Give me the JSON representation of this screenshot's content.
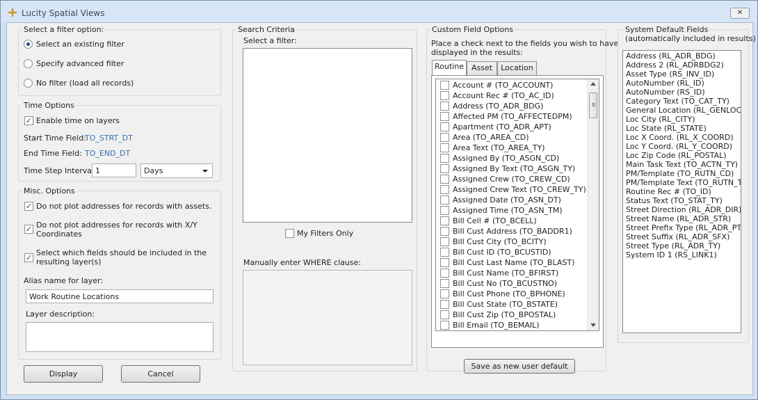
{
  "window": {
    "title": "Lucity Spatial Views",
    "close_label": "✕"
  },
  "filter_option": {
    "title": "Select a filter option:",
    "options": [
      {
        "label": "Select an existing filter",
        "selected": true
      },
      {
        "label": "Specify advanced filter",
        "selected": false
      },
      {
        "label": "No filter (load all records)",
        "selected": false
      }
    ]
  },
  "time_options": {
    "title": "Time Options",
    "enable_label": "Enable time on layers",
    "enable_checked": true,
    "start_label": "Start Time Field:",
    "start_value": "TO_STRT_DT",
    "end_label": "End Time Field:",
    "end_value": "TO_END_DT",
    "step_label": "Time Step Interval:",
    "step_value": "1",
    "step_unit": "Days"
  },
  "misc": {
    "title": "Misc. Options",
    "opt1": "Do not plot addresses for records with assets.",
    "opt2_line1": "Do not plot addresses for records with X/Y",
    "opt2_line2": "Coordinates",
    "opt3_line1": "Select which fields should be included in the",
    "opt3_line2": "resulting layer(s)",
    "alias_label": "Alias name for layer:",
    "alias_value": "Work Routine Locations",
    "desc_label": "Layer description:",
    "desc_value": ""
  },
  "buttons": {
    "display": "Display",
    "cancel": "Cancel",
    "save_default": "Save as new user default"
  },
  "search": {
    "title": "Search Criteria",
    "select_label": "Select a filter:",
    "my_filters_label": "My Filters Only",
    "where_label": "Manually enter WHERE clause:"
  },
  "custom": {
    "title": "Custom Field Options",
    "instruction_line1": "Place a check next to the fields you wish to have",
    "instruction_line2": "displayed in the results:",
    "tabs": [
      "Routine",
      "Asset",
      "Location"
    ],
    "fields": [
      "Account # (TO_ACCOUNT)",
      "Account Rec # (TO_AC_ID)",
      "Address (TO_ADR_BDG)",
      "Affected PM (TO_AFFECTEDPM)",
      "Apartment (TO_ADR_APT)",
      "Area (TO_AREA_CD)",
      "Area Text (TO_AREA_TY)",
      "Assigned By (TO_ASGN_CD)",
      "Assigned By Text (TO_ASGN_TY)",
      "Assigned Crew (TO_CREW_CD)",
      "Assigned Crew Text (TO_CREW_TY)",
      "Assigned Date (TO_ASN_DT)",
      "Assigned Time (TO_ASN_TM)",
      "Bill Cell # (TO_BCELL)",
      "Bill Cust Address (TO_BADDR1)",
      "Bill Cust City (TO_BCITY)",
      "Bill Cust ID (TO_BCUSTID)",
      "Bill Cust Last Name (TO_BLAST)",
      "Bill Cust Name (TO_BFIRST)",
      "Bill Cust No (TO_BCUSTNO)",
      "Bill Cust Phone (TO_BPHONE)",
      "Bill Cust State (TO_BSTATE)",
      "Bill Cust Zip (TO_BPOSTAL)",
      "Bill Email (TO_BEMAIL)"
    ]
  },
  "system": {
    "title_line1": "System Default Fields",
    "title_line2": "(automatically included in results)",
    "fields": [
      "Address (RL_ADR_BDG)",
      "Address 2 (RL_ADRBDG2)",
      "Asset Type (RS_INV_ID)",
      "AutoNumber (RL_ID)",
      "AutoNumber (RS_ID)",
      "Category Text (TO_CAT_TY)",
      "General Location (RL_GENLOC)",
      "Loc City (RL_CITY)",
      "Loc State (RL_STATE)",
      "Loc X Coord. (RL_X_COORD)",
      "Loc Y Coord. (RL_Y_COORD)",
      "Loc Zip Code (RL_POSTAL)",
      "Main Task Text (TO_ACTN_TY)",
      "PM/Template (TO_RUTN_CD)",
      "PM/Template Text (TO_RUTN_TY)",
      "Routine Rec # (TO_ID)",
      "Status Text (TO_STAT_TY)",
      "Street Direction (RL_ADR_DIR)",
      "Street Name (RL_ADR_STR)",
      "Street Prefix Type (RL_ADR_PT)",
      "Street Suffix (RL_ADR_SFX)",
      "Street Type (RL_ADR_TY)",
      "System ID 1 (RS_LINK1)"
    ]
  }
}
